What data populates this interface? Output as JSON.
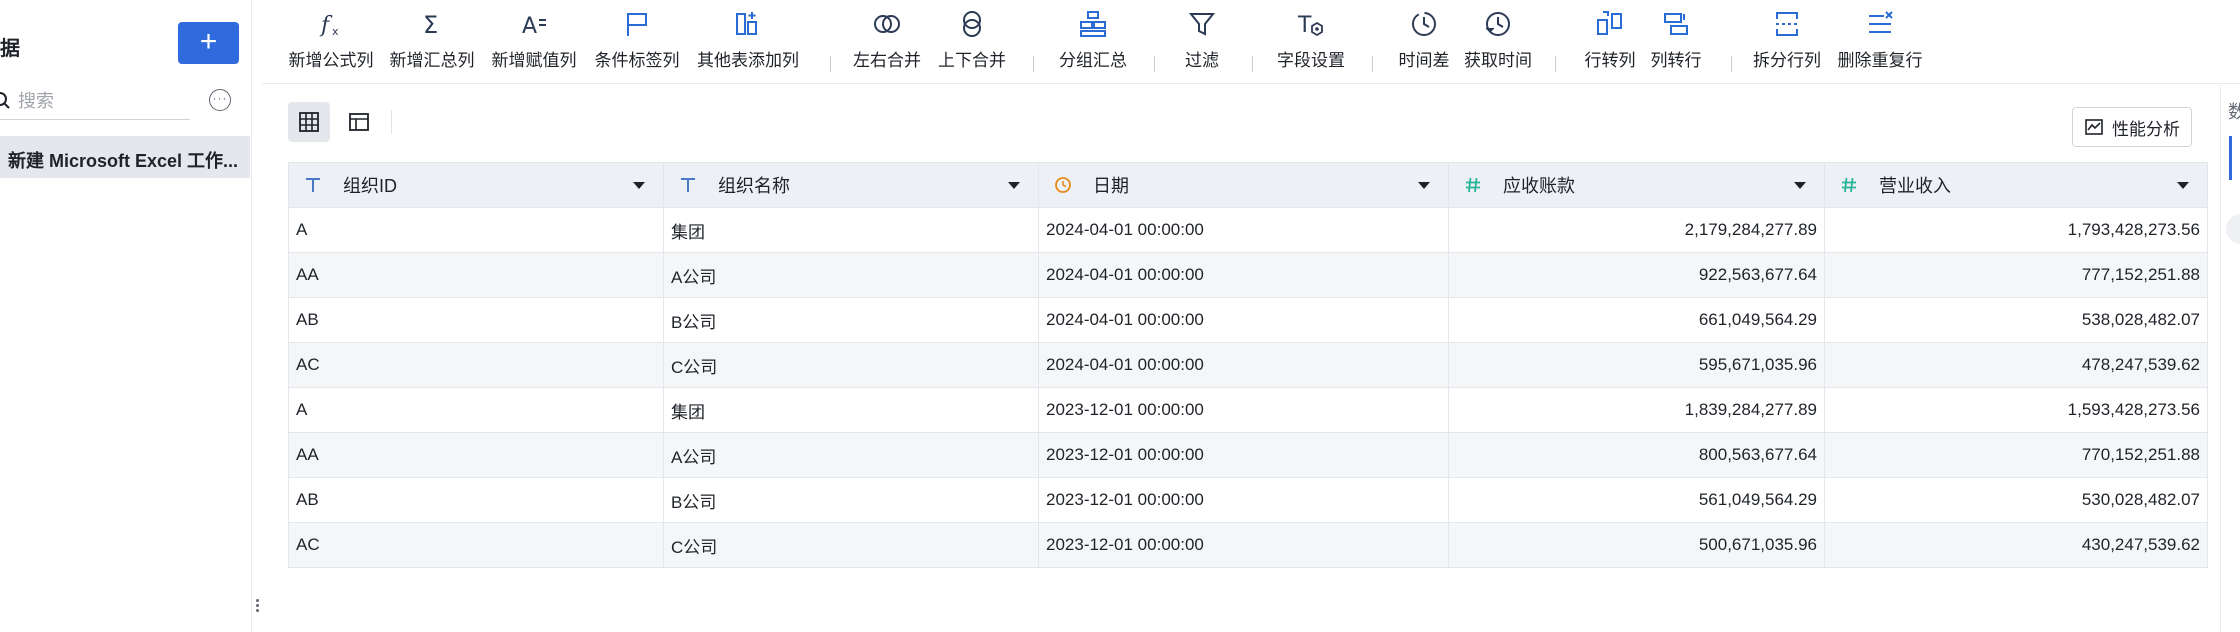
{
  "sidebar": {
    "title": "据",
    "add_label": "+",
    "search_placeholder": "搜索",
    "more_label": "···",
    "file_name": "新建 Microsoft Excel 工作..."
  },
  "toolbar": {
    "items": [
      {
        "label": "新增公式列",
        "icon": "formula-icon"
      },
      {
        "label": "新增汇总列",
        "icon": "sigma-icon"
      },
      {
        "label": "新增赋值列",
        "icon": "assign-icon"
      },
      {
        "label": "条件标签列",
        "icon": "flag-icon"
      },
      {
        "label": "其他表添加列",
        "icon": "add-column-icon"
      },
      {
        "label": "左右合并",
        "icon": "merge-horizontal-icon"
      },
      {
        "label": "上下合并",
        "icon": "merge-vertical-icon"
      },
      {
        "label": "分组汇总",
        "icon": "group-icon"
      },
      {
        "label": "过滤",
        "icon": "filter-icon"
      },
      {
        "label": "字段设置",
        "icon": "field-settings-icon"
      },
      {
        "label": "时间差",
        "icon": "time-diff-icon"
      },
      {
        "label": "获取时间",
        "icon": "get-time-icon"
      },
      {
        "label": "行转列",
        "icon": "row-to-column-icon"
      },
      {
        "label": "列转行",
        "icon": "column-to-row-icon"
      },
      {
        "label": "拆分行列",
        "icon": "split-icon"
      },
      {
        "label": "删除重复行",
        "icon": "dedupe-icon"
      }
    ]
  },
  "right_panel": {
    "char": "数"
  },
  "actions": {
    "perf_label": "性能分析"
  },
  "table": {
    "columns": [
      {
        "label": "组织ID",
        "type": "text"
      },
      {
        "label": "组织名称",
        "type": "text"
      },
      {
        "label": "日期",
        "type": "date"
      },
      {
        "label": "应收账款",
        "type": "number"
      },
      {
        "label": "营业收入",
        "type": "number"
      }
    ],
    "rows": [
      [
        "A",
        "集团",
        "2024-04-01 00:00:00",
        "2,179,284,277.89",
        "1,793,428,273.56"
      ],
      [
        "AA",
        "A公司",
        "2024-04-01 00:00:00",
        "922,563,677.64",
        "777,152,251.88"
      ],
      [
        "AB",
        "B公司",
        "2024-04-01 00:00:00",
        "661,049,564.29",
        "538,028,482.07"
      ],
      [
        "AC",
        "C公司",
        "2024-04-01 00:00:00",
        "595,671,035.96",
        "478,247,539.62"
      ],
      [
        "A",
        "集团",
        "2023-12-01 00:00:00",
        "1,839,284,277.89",
        "1,593,428,273.56"
      ],
      [
        "AA",
        "A公司",
        "2023-12-01 00:00:00",
        "800,563,677.64",
        "770,152,251.88"
      ],
      [
        "AB",
        "B公司",
        "2023-12-01 00:00:00",
        "561,049,564.29",
        "530,028,482.07"
      ],
      [
        "AC",
        "C公司",
        "2023-12-01 00:00:00",
        "500,671,035.96",
        "430,247,539.62"
      ]
    ]
  },
  "colors": {
    "accent": "#2f6bdc",
    "text_type": "#4a78c9",
    "date_type": "#e8891a",
    "number_type": "#2bb39a"
  }
}
